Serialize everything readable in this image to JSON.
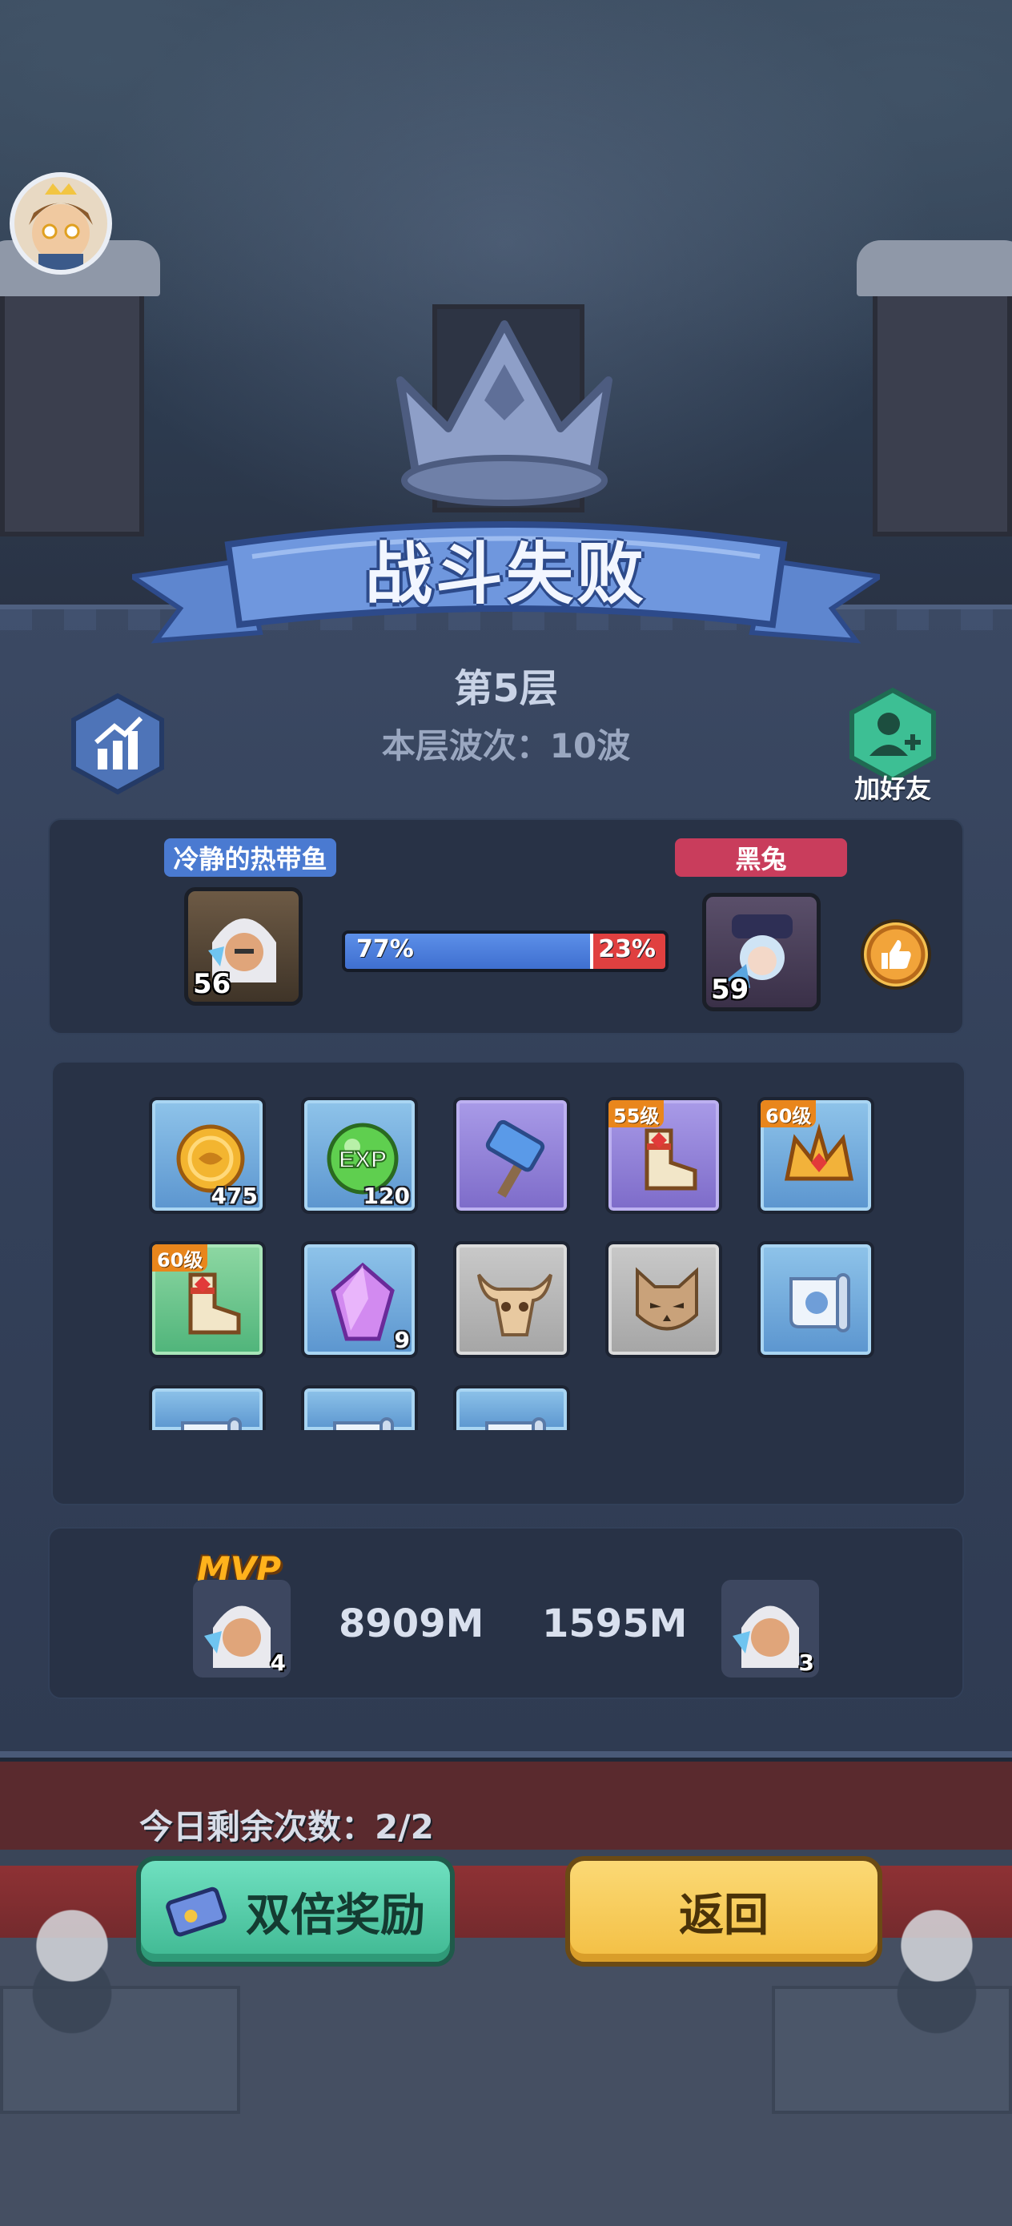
{
  "header": {
    "result_title": "战斗失败",
    "floor_title": "第5层",
    "wave_text": "本层波次：10波",
    "add_friend_label": "加好友"
  },
  "versus": {
    "left_player_name": "冷静的热带鱼",
    "right_player_name": "黑兔",
    "left_level": "56",
    "right_level": "59",
    "left_percent_label": "77%",
    "right_percent_label": "23%",
    "left_share": 0.77,
    "left_color": "#4a7ad1",
    "right_color": "#c93d5c"
  },
  "rewards": [
    {
      "icon": "gold-coin-icon",
      "count": "475",
      "badge": "",
      "bg": "blue"
    },
    {
      "icon": "exp-orb-icon",
      "count": "120",
      "badge": "",
      "bg": "blue"
    },
    {
      "icon": "hammer-icon",
      "count": "",
      "badge": "",
      "bg": "purple"
    },
    {
      "icon": "boots-icon",
      "count": "",
      "badge": "55级",
      "bg": "purple"
    },
    {
      "icon": "crown-helmet-icon",
      "count": "",
      "badge": "60级",
      "bg": "blue"
    },
    {
      "icon": "boots-icon",
      "count": "",
      "badge": "60级",
      "bg": "green"
    },
    {
      "icon": "purple-crystal-icon",
      "count": "9",
      "badge": "",
      "bg": "blue"
    },
    {
      "icon": "bull-skull-icon",
      "count": "",
      "badge": "",
      "bg": "grey"
    },
    {
      "icon": "cat-mask-icon",
      "count": "",
      "badge": "",
      "bg": "grey"
    },
    {
      "icon": "scroll-icon",
      "count": "",
      "badge": "",
      "bg": "blue"
    },
    {
      "icon": "scroll-icon",
      "count": "",
      "badge": "",
      "bg": "blue"
    },
    {
      "icon": "scroll-icon",
      "count": "",
      "badge": "",
      "bg": "blue"
    },
    {
      "icon": "scroll-icon",
      "count": "",
      "badge": "",
      "bg": "blue"
    }
  ],
  "mvp": {
    "label": "MVP",
    "left_count": "4",
    "right_count": "3",
    "left_damage": "8909M",
    "right_damage": "1595M"
  },
  "footer": {
    "remaining_text": "今日剩余次数：2/2",
    "double_reward_label": "双倍奖励",
    "back_label": "返回"
  }
}
